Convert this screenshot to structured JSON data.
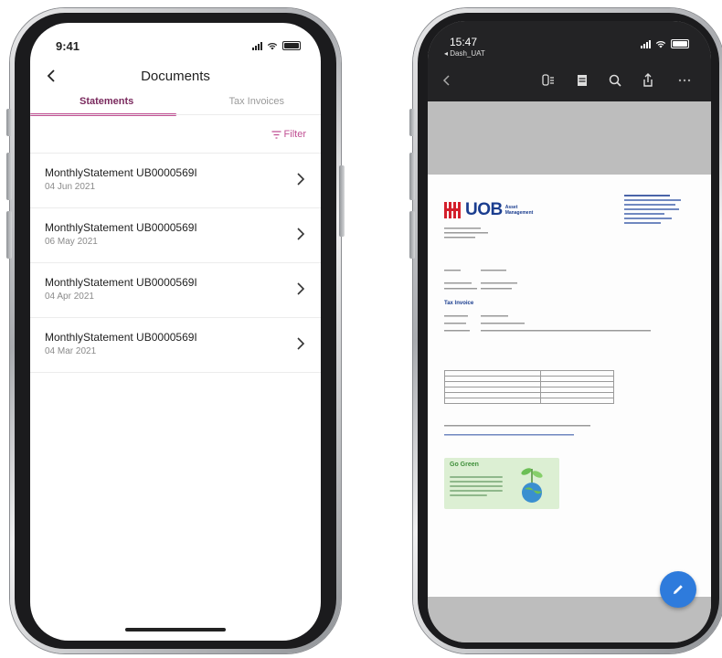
{
  "left_phone": {
    "status_time": "9:41",
    "nav": {
      "title": "Documents"
    },
    "tabs": [
      {
        "label": "Statements",
        "active": true
      },
      {
        "label": "Tax Invoices",
        "active": false
      }
    ],
    "filter_label": "Filter",
    "documents": [
      {
        "title": "MonthlyStatement UB0000569I",
        "date": "04 Jun 2021"
      },
      {
        "title": "MonthlyStatement UB0000569I",
        "date": "06 May 2021"
      },
      {
        "title": "MonthlyStatement UB0000569I",
        "date": "04 Apr 2021"
      },
      {
        "title": "MonthlyStatement UB0000569I",
        "date": "04 Mar 2021"
      }
    ],
    "colors": {
      "accent": "#c04f93",
      "active_tab_text": "#7a2a5e"
    }
  },
  "right_phone": {
    "status_time": "15:47",
    "back_app": "◂ Dash_UAT",
    "document": {
      "logo_text": "UOB",
      "logo_subtext_line1": "Asset",
      "logo_subtext_line2": "Management",
      "section_title": "Tax Invoice",
      "promo_title": "Go Green"
    },
    "colors": {
      "brand": "#1a3d8f",
      "fab": "#2e7bdc",
      "toolbar_bg": "#232325"
    }
  }
}
